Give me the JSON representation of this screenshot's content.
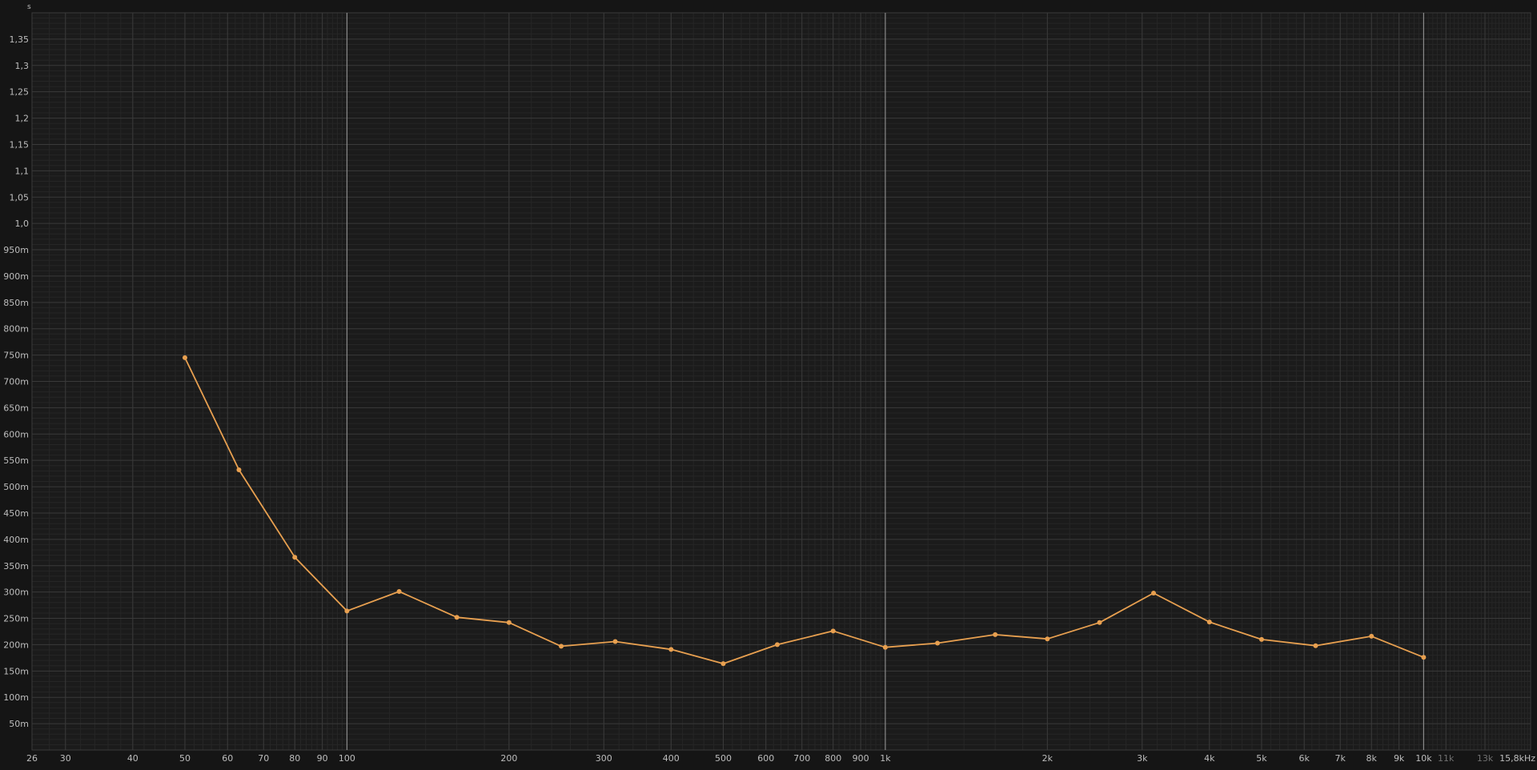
{
  "chart_data": {
    "type": "line",
    "title": "",
    "ylabel": "s",
    "xunit": "Hz",
    "xscale": "log",
    "xlim": [
      26,
      15800
    ],
    "ylim": [
      0,
      1.4
    ],
    "grid": true,
    "legend": "none",
    "colors": {
      "background": "#151515",
      "plot_background": "#1b1b1b",
      "grid_minor": "#262626",
      "grid_major": "#3a3a3a",
      "grid_decade": "#8a8a8a",
      "tick_text": "#bdbdbd",
      "tick_text_dim": "#707070",
      "line": "#e8a050"
    },
    "x_ticks": [
      {
        "value": 26,
        "label": "26",
        "dim": false
      },
      {
        "value": 30,
        "label": "30",
        "dim": false
      },
      {
        "value": 40,
        "label": "40",
        "dim": false
      },
      {
        "value": 50,
        "label": "50",
        "dim": false
      },
      {
        "value": 60,
        "label": "60",
        "dim": false
      },
      {
        "value": 70,
        "label": "70",
        "dim": false
      },
      {
        "value": 80,
        "label": "80",
        "dim": false
      },
      {
        "value": 90,
        "label": "90",
        "dim": false
      },
      {
        "value": 100,
        "label": "100",
        "dim": false
      },
      {
        "value": 200,
        "label": "200",
        "dim": false
      },
      {
        "value": 300,
        "label": "300",
        "dim": false
      },
      {
        "value": 400,
        "label": "400",
        "dim": false
      },
      {
        "value": 500,
        "label": "500",
        "dim": false
      },
      {
        "value": 600,
        "label": "600",
        "dim": false
      },
      {
        "value": 700,
        "label": "700",
        "dim": false
      },
      {
        "value": 800,
        "label": "800",
        "dim": false
      },
      {
        "value": 900,
        "label": "900",
        "dim": false
      },
      {
        "value": 1000,
        "label": "1k",
        "dim": false
      },
      {
        "value": 2000,
        "label": "2k",
        "dim": false
      },
      {
        "value": 3000,
        "label": "3k",
        "dim": false
      },
      {
        "value": 4000,
        "label": "4k",
        "dim": false
      },
      {
        "value": 5000,
        "label": "5k",
        "dim": false
      },
      {
        "value": 6000,
        "label": "6k",
        "dim": false
      },
      {
        "value": 7000,
        "label": "7k",
        "dim": false
      },
      {
        "value": 8000,
        "label": "8k",
        "dim": false
      },
      {
        "value": 9000,
        "label": "9k",
        "dim": false
      },
      {
        "value": 10000,
        "label": "10k",
        "dim": false
      },
      {
        "value": 11000,
        "label": "11k",
        "dim": true
      },
      {
        "value": 13000,
        "label": "13k",
        "dim": true
      },
      {
        "value": 15800,
        "label": "15,8kHz",
        "dim": false
      }
    ],
    "y_ticks": [
      {
        "value": 0.05,
        "label": "50m"
      },
      {
        "value": 0.1,
        "label": "100m"
      },
      {
        "value": 0.15,
        "label": "150m"
      },
      {
        "value": 0.2,
        "label": "200m"
      },
      {
        "value": 0.25,
        "label": "250m"
      },
      {
        "value": 0.3,
        "label": "300m"
      },
      {
        "value": 0.35,
        "label": "350m"
      },
      {
        "value": 0.4,
        "label": "400m"
      },
      {
        "value": 0.45,
        "label": "450m"
      },
      {
        "value": 0.5,
        "label": "500m"
      },
      {
        "value": 0.55,
        "label": "550m"
      },
      {
        "value": 0.6,
        "label": "600m"
      },
      {
        "value": 0.65,
        "label": "650m"
      },
      {
        "value": 0.7,
        "label": "700m"
      },
      {
        "value": 0.75,
        "label": "750m"
      },
      {
        "value": 0.8,
        "label": "800m"
      },
      {
        "value": 0.85,
        "label": "850m"
      },
      {
        "value": 0.9,
        "label": "900m"
      },
      {
        "value": 0.95,
        "label": "950m"
      },
      {
        "value": 1.0,
        "label": "1,0"
      },
      {
        "value": 1.05,
        "label": "1,05"
      },
      {
        "value": 1.1,
        "label": "1,1"
      },
      {
        "value": 1.15,
        "label": "1,15"
      },
      {
        "value": 1.2,
        "label": "1,2"
      },
      {
        "value": 1.25,
        "label": "1,25"
      },
      {
        "value": 1.3,
        "label": "1,3"
      },
      {
        "value": 1.35,
        "label": "1,35"
      }
    ],
    "series": [
      {
        "x": [
          50,
          63,
          80,
          100,
          125,
          160,
          200,
          250,
          315,
          400,
          500,
          630,
          800,
          1000,
          1250,
          1600,
          2000,
          2500,
          3150,
          4000,
          5000,
          6300,
          8000,
          10000
        ],
        "y": [
          0.745,
          0.532,
          0.366,
          0.264,
          0.301,
          0.252,
          0.242,
          0.197,
          0.206,
          0.191,
          0.164,
          0.2,
          0.226,
          0.195,
          0.203,
          0.219,
          0.211,
          0.242,
          0.298,
          0.243,
          0.21,
          0.198,
          0.216,
          0.176
        ]
      }
    ]
  }
}
